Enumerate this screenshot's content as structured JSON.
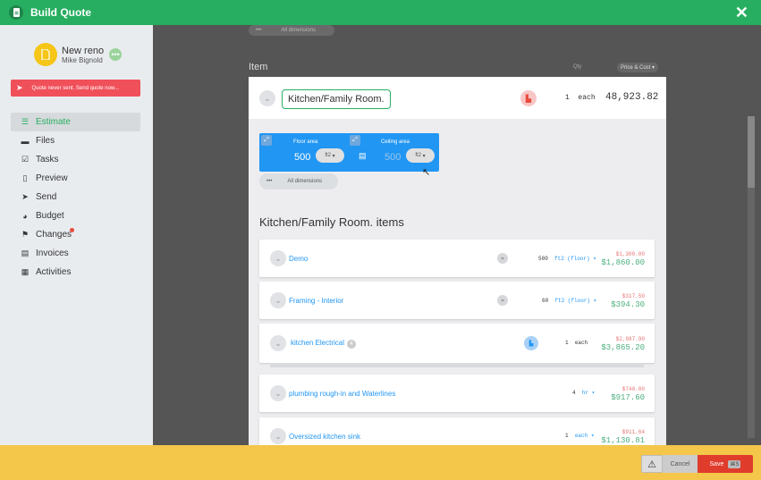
{
  "window": {
    "title": "Build Quote",
    "close_icon": "close-icon"
  },
  "project": {
    "name": "New reno",
    "customer": "Mike Bignold"
  },
  "alert": {
    "text": "Quote never sent. Send quote now..."
  },
  "nav": [
    {
      "label": "Estimate",
      "icon": "list-icon",
      "active": true
    },
    {
      "label": "Files",
      "icon": "folder-icon"
    },
    {
      "label": "Tasks",
      "icon": "check-square-icon"
    },
    {
      "label": "Preview",
      "icon": "file-icon"
    },
    {
      "label": "Send",
      "icon": "send-icon"
    },
    {
      "label": "Budget",
      "icon": "pie-chart-icon"
    },
    {
      "label": "Changes",
      "icon": "flag-icon",
      "notification": true
    },
    {
      "label": "Invoices",
      "icon": "invoice-icon"
    },
    {
      "label": "Activities",
      "icon": "activities-icon"
    }
  ],
  "top": {
    "all_dimensions": "All dimensions",
    "item_header": "Item",
    "qty_header": "Qty",
    "price_header": "Price & Cost"
  },
  "room": {
    "name": "Kitchen/Family Room.",
    "qty": "1",
    "unit": "each",
    "total": "48,923.82",
    "floor_area_label": "Floor area",
    "floor_area_value": "500",
    "floor_area_unit": "ft2",
    "ceiling_area_label": "Ceiling area",
    "ceiling_area_value": "500",
    "ceiling_area_unit": "ft2",
    "all_dimensions": "All dimensions",
    "items_title": "Kitchen/Family Room. items"
  },
  "items": [
    {
      "name": "Demo",
      "qty": "500",
      "unit": "ft2 (floor)",
      "cost": "$1,300.00",
      "price": "$1,860.00"
    },
    {
      "name": "Framing - Interior",
      "qty": "60",
      "unit": "ft2 (floor)",
      "cost": "$317.50",
      "price": "$394.30"
    },
    {
      "name": "kitchen Electrical",
      "badge": "4",
      "qty": "1",
      "unit": "each",
      "cost": "$2,987.90",
      "price": "$3,865.20"
    },
    {
      "name": "plumbing rough-in and Waterlines",
      "qty": "4",
      "unit": "hr",
      "cost": "$740.00",
      "price": "$917.60"
    },
    {
      "name": "Oversized kitchen sink",
      "qty": "1",
      "unit": "each",
      "cost": "$911.64",
      "price": "$1,130.81"
    }
  ],
  "footer": {
    "cancel": "Cancel",
    "save": "Save",
    "save_shortcut": "⌘S"
  },
  "colors": {
    "brand": "#27ae60",
    "primary": "#2196f3",
    "danger": "#e03c2c",
    "footer": "#f4c64a"
  }
}
